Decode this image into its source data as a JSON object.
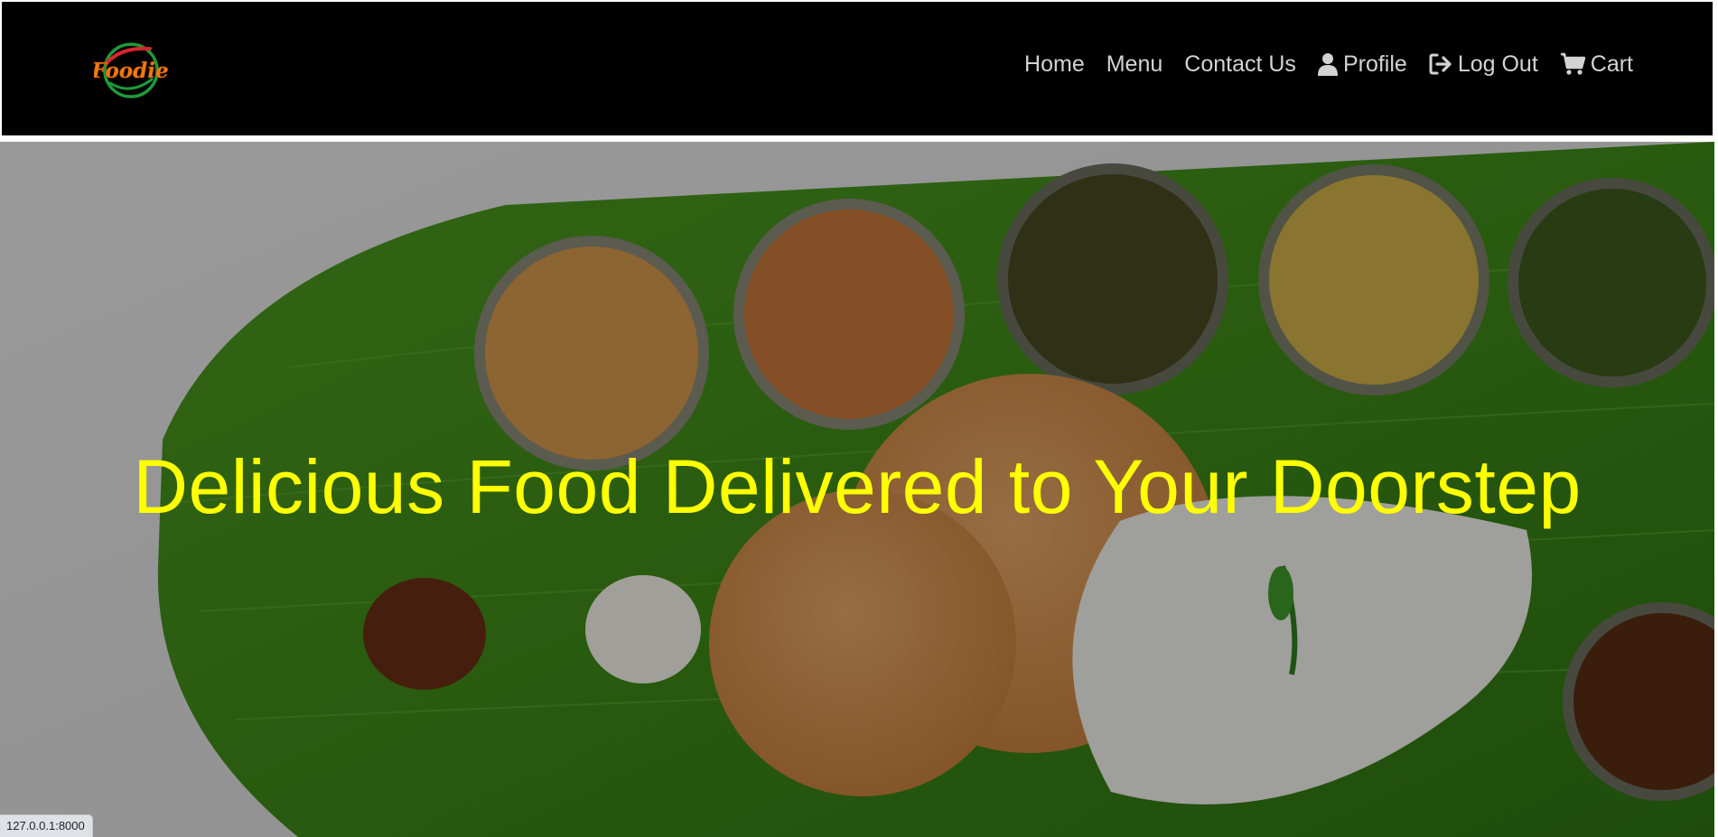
{
  "brand": {
    "logo_text": "Foodie",
    "logo_alt": "Foodie logo"
  },
  "nav": {
    "items": [
      {
        "label": "Home",
        "icon": ""
      },
      {
        "label": "Menu",
        "icon": ""
      },
      {
        "label": "Contact Us",
        "icon": ""
      },
      {
        "label": "Profile",
        "icon": "user-icon"
      },
      {
        "label": "Log Out",
        "icon": "sign-out-icon"
      },
      {
        "label": "Cart",
        "icon": "cart-icon"
      }
    ]
  },
  "hero": {
    "title": "Delicious Food Delivered to Your Doorstep",
    "background": "thali-on-banana-leaf"
  },
  "status_bar": {
    "url": "127.0.0.1:8000"
  },
  "colors": {
    "navbar_bg": "#000000",
    "nav_text": "#d3d3d3",
    "hero_title": "#ffff00",
    "logo_orange": "#f07a12",
    "logo_green": "#1f9a3a",
    "logo_red": "#d8262b"
  }
}
